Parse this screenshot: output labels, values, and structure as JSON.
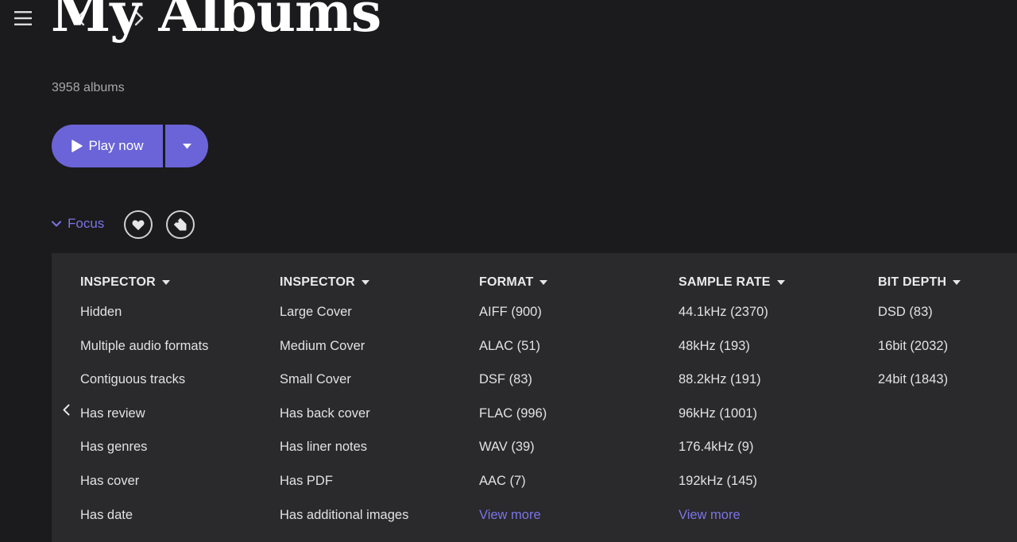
{
  "page": {
    "title": "My Albums",
    "album_count": "3958 albums"
  },
  "actions": {
    "play_label": "Play now"
  },
  "focus": {
    "label": "Focus"
  },
  "colors": {
    "accent": "#6a64d8",
    "link": "#7b74e6",
    "background": "#1b1a1c",
    "panel": "#2a292b"
  },
  "filters": [
    {
      "header": "INSPECTOR",
      "items": [
        "Hidden",
        "Multiple audio formats",
        "Contiguous tracks",
        "Has review",
        "Has genres",
        "Has cover",
        "Has date"
      ]
    },
    {
      "header": "INSPECTOR",
      "items": [
        "Large Cover",
        "Medium Cover",
        "Small Cover",
        "Has back cover",
        "Has liner notes",
        "Has PDF",
        "Has additional images"
      ]
    },
    {
      "header": "FORMAT",
      "items": [
        "AIFF (900)",
        "ALAC (51)",
        "DSF (83)",
        "FLAC (996)",
        "WAV (39)",
        "AAC (7)"
      ],
      "view_more": "View more"
    },
    {
      "header": "SAMPLE RATE",
      "items": [
        "44.1kHz (2370)",
        "48kHz (193)",
        "88.2kHz (191)",
        "96kHz (1001)",
        "176.4kHz (9)",
        "192kHz (145)"
      ],
      "view_more": "View more"
    },
    {
      "header": "BIT DEPTH",
      "items": [
        "DSD (83)",
        "16bit (2032)",
        "24bit (1843)"
      ]
    }
  ]
}
